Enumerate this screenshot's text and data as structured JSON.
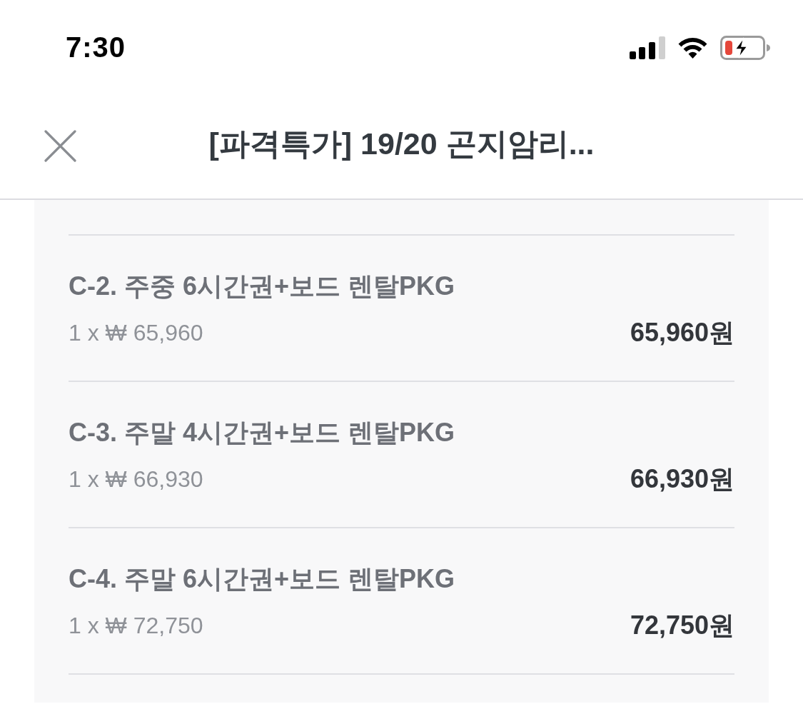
{
  "status_bar": {
    "time": "7:30"
  },
  "header": {
    "title": "[파격특가] 19/20 곤지암리..."
  },
  "items": [
    {
      "name": "C-2. 주중 6시간권+보드 렌탈PKG",
      "unit_price": "1 x ₩ 65,960",
      "total": "65,960원"
    },
    {
      "name": "C-3. 주말 4시간권+보드 렌탈PKG",
      "unit_price": "1 x ₩ 66,930",
      "total": "66,930원"
    },
    {
      "name": "C-4. 주말 6시간권+보드 렌탈PKG",
      "unit_price": "1 x ₩ 72,750",
      "total": "72,750원"
    }
  ]
}
